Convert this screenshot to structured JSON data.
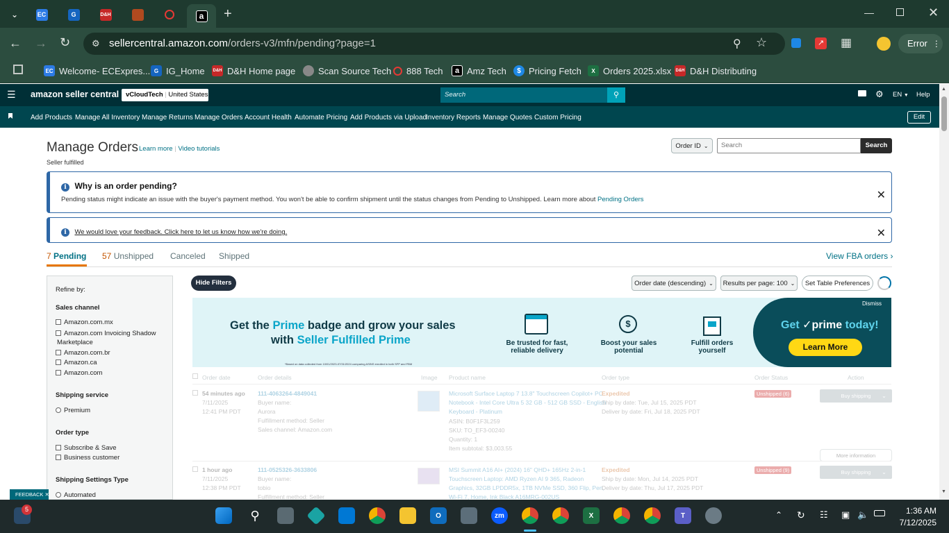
{
  "browser": {
    "tabs": [
      {
        "label": "EC",
        "color": "#2c7be5"
      },
      {
        "label": "G",
        "color": "#1565c0"
      },
      {
        "label": "D&H",
        "color": "#c62828"
      },
      {
        "label": "",
        "color": "#b04a1f"
      },
      {
        "label": "",
        "color": "#e53935"
      },
      {
        "label": "a",
        "color": "#000000"
      }
    ],
    "new_tab": "+",
    "url_host": "sellercentral.amazon.com",
    "url_path": "/orders-v3/mfn/pending?page=1",
    "error_label": "Error",
    "bookmarks": [
      {
        "label": "Welcome- ECExpres...",
        "icon": "EC",
        "color": "#2c7be5"
      },
      {
        "label": "IG_Home",
        "icon": "G",
        "color": "#1565c0"
      },
      {
        "label": "D&H Home page",
        "icon": "D&H",
        "color": "#c62828"
      },
      {
        "label": "Scan Source Tech",
        "icon": "",
        "color": "#888888"
      },
      {
        "label": "888 Tech",
        "icon": "",
        "color": "#e53935"
      },
      {
        "label": "Amz Tech",
        "icon": "a",
        "color": "#000000"
      },
      {
        "label": "Pricing Fetch",
        "icon": "$",
        "color": "#1e88e5"
      },
      {
        "label": "Orders 2025.xlsx",
        "icon": "X",
        "color": "#1d6f42"
      },
      {
        "label": "D&H Distributing",
        "icon": "D&H",
        "color": "#c62828"
      }
    ]
  },
  "amazon": {
    "logo": "amazon seller central",
    "account_name": "vCloudTech",
    "account_region": "United States",
    "search_placeholder": "Search",
    "lang": "EN",
    "help": "Help",
    "nav_items": [
      "Add Products",
      "Manage All Inventory",
      "Manage Returns",
      "Manage Orders",
      "Account Health",
      "Automate Pricing",
      "Add Products via Upload",
      "Inventory Reports",
      "Manage Quotes",
      "Custom Pricing"
    ],
    "edit": "Edit"
  },
  "page": {
    "title": "Manage Orders",
    "learn_more": "Learn more",
    "video_tutorials": "Video tutorials",
    "subtitle": "Seller fulfilled",
    "search_type": "Order ID",
    "search_placeholder": "Search",
    "search_button": "Search",
    "banner1_title": "Why is an order pending?",
    "banner1_text": "Pending status might indicate an issue with the buyer's payment method. You won't be able to confirm shipment until the status changes from Pending to Unshipped. Learn more about",
    "banner1_link": "Pending Orders",
    "banner2_link": "We would love your feedback. Click here to let us know how we're doing.",
    "tab_pending_count": "7",
    "tab_pending": "Pending",
    "tab_unshipped_count": "57",
    "tab_unshipped": "Unshipped",
    "tab_canceled": "Canceled",
    "tab_shipped": "Shipped",
    "view_fba": "View FBA orders",
    "hide_filters": "Hide Filters",
    "sort": "Order date (descending)",
    "results": "Results per page: 100",
    "table_prefs": "Set Table Preferences"
  },
  "sidebar": {
    "refine": "Refine by:",
    "sales_channel": "Sales channel",
    "channels": [
      "Amazon.com.mx",
      "Amazon.com Invoicing Shadow",
      "Marketplace",
      "Amazon.com.br",
      "Amazon.ca",
      "Amazon.com"
    ],
    "shipping_service": "Shipping service",
    "premium": "Premium",
    "order_type": "Order type",
    "subscribe": "Subscribe & Save",
    "business": "Business customer",
    "shipping_settings": "Shipping Settings Type",
    "automated": "Automated",
    "feedback": "FEEDBACK"
  },
  "promo": {
    "dismiss": "Dismiss",
    "headline_1": "Get the",
    "headline_prime": "Prime",
    "headline_2": "badge and grow your sales",
    "headline_3": "with",
    "headline_sfp": "Seller Fulfilled Prime",
    "benefit_1a": "Be trusted for fast,",
    "benefit_1b": "reliable delivery",
    "benefit_2a": "Boost your sales",
    "benefit_2b": "potential",
    "benefit_3a": "Fulfill orders",
    "benefit_3b": "yourself",
    "cta_title_1": "Get",
    "cta_title_prime": "prime",
    "cta_title_2": "today!",
    "cta_button": "Learn More",
    "footnote": "*Based on data collected from 10/01/2023-07/31/2024 comparing ASINS enrolled in both SFP and FBM"
  },
  "table": {
    "headers": [
      "Order date",
      "Order details",
      "Image",
      "Product name",
      "Order type",
      "Order Status",
      "Action"
    ],
    "rows": [
      {
        "age": "54 minutes ago",
        "date": "7/11/2025",
        "time": "12:41 PM PDT",
        "order_id": "111-4063264-4849041",
        "buyer_label": "Buyer name:",
        "buyer": "Aurora",
        "fulfill": "Fulfillment method: Seller",
        "channel": "Sales channel: Amazon.com",
        "product_1": "Microsoft Surface Laptop 7 13.8\" Touchscreen Copilot+ PC",
        "product_2": "Notebook - Intel Core Ultra 5 32 GB - 512 GB SSD - English",
        "product_3": "Keyboard - Platinum",
        "asin": "ASIN: B0F1F3L259",
        "sku": "SKU: TO_EF3-00240",
        "qty": "Quantity: 1",
        "subtotal": "Item subtotal: $3,003.55",
        "type": "Expedited",
        "ship_by": "Ship by date: Tue, Jul 15, 2025 PDT",
        "deliver_by": "Deliver by date: Fri, Jul 18, 2025 PDT",
        "status": "Unshipped (6)",
        "action": "Buy shipping",
        "more": "More information"
      },
      {
        "age": "1 hour ago",
        "date": "7/11/2025",
        "time": "12:38 PM PDT",
        "order_id": "111-0525326-3633806",
        "buyer_label": "Buyer name:",
        "buyer": "tobio",
        "fulfill": "Fulfillment method: Seller",
        "product_1": "MSI Summit A16 AI+ (2024) 16\" QHD+ 165Hz 2-in-1",
        "product_2": "Touchscreen Laptop: AMD Ryzen AI 9 365, Radeon",
        "product_3": "Graphics, 32GB LPDDR5x, 1TB NVMe SSD, 360 Flip, Pen,",
        "product_4": "Wi-Fi 7, Home, Ink Black A16MRG-002US",
        "type": "Expedited",
        "ship_by": "Ship by date: Mon, Jul 14, 2025 PDT",
        "deliver_by": "Deliver by date: Thu, Jul 17, 2025 PDT",
        "status": "Unshipped (9)",
        "action": "Buy shipping"
      }
    ]
  },
  "taskbar": {
    "time": "1:36 AM",
    "date": "7/12/2025",
    "notif_count": "5"
  }
}
